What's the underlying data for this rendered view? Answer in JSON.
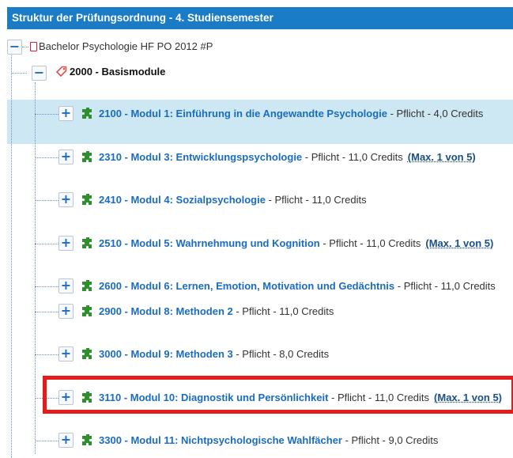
{
  "header": {
    "title": "Struktur der Prüfungsordnung - 4. Studiensemester"
  },
  "tree": {
    "root": {
      "label": "Bachelor Psychologie HF PO 2012 #P",
      "toggle": "−",
      "icon": "document-icon",
      "icon_color": "#d3223a"
    },
    "group": {
      "label": "2000 - Basismodule",
      "toggle": "−",
      "icon": "tag-icon",
      "icon_color": "#e05050"
    },
    "modules": [
      {
        "toggle": "+",
        "title": "2100 - Modul 1: Einführung in die Angewandte Psychologie",
        "meta": " - Pflicht - 4,0 Credits",
        "max": "",
        "highlighted": true
      },
      {
        "toggle": "+",
        "title": "2310 - Modul 3: Entwicklungspsychologie",
        "meta": " - Pflicht - 11,0 Credits",
        "max": "(Max. 1 von 5)",
        "highlighted": false
      },
      {
        "toggle": "+",
        "title": "2410 - Modul 4: Sozialpsychologie",
        "meta": " - Pflicht - 11,0 Credits",
        "max": "",
        "highlighted": false
      },
      {
        "toggle": "+",
        "title": "2510 - Modul 5: Wahrnehmung und Kognition",
        "meta": " - Pflicht - 11,0 Credits",
        "max": "(Max. 1 von 5)",
        "highlighted": false
      },
      {
        "toggle": "+",
        "title": "2600 - Modul 6: Lernen, Emotion, Motivation und Gedächtnis",
        "meta": " - Pflicht - 11,0 Credits",
        "max": "",
        "highlighted": false
      },
      {
        "toggle": "+",
        "title": "2900 - Modul 8: Methoden 2",
        "meta": " - Pflicht - 11,0 Credits",
        "max": "",
        "highlighted": false
      },
      {
        "toggle": "+",
        "title": "3000 - Modul 9: Methoden 3",
        "meta": " - Pflicht - 8,0 Credits",
        "max": "",
        "highlighted": false
      },
      {
        "toggle": "+",
        "title": "3110 - Modul 10: Diagnostik und Persönlichkeit",
        "meta": " - Pflicht - 11,0 Credits",
        "max": "(Max. 1 von 5)",
        "highlighted": false,
        "boxed": true
      },
      {
        "toggle": "+",
        "title": "3300 - Modul 11: Nichtpsychologische Wahlfächer",
        "meta": " - Pflicht - 9,0 Credits",
        "max": "",
        "highlighted": false
      }
    ]
  },
  "colors": {
    "header_bg": "#1a7cc7",
    "link": "#1a6cc0",
    "highlight": "#cde8f2",
    "puzzle": "#2f8f2f",
    "callout_border": "#e41c1c"
  },
  "module_icon": "puzzle-icon"
}
